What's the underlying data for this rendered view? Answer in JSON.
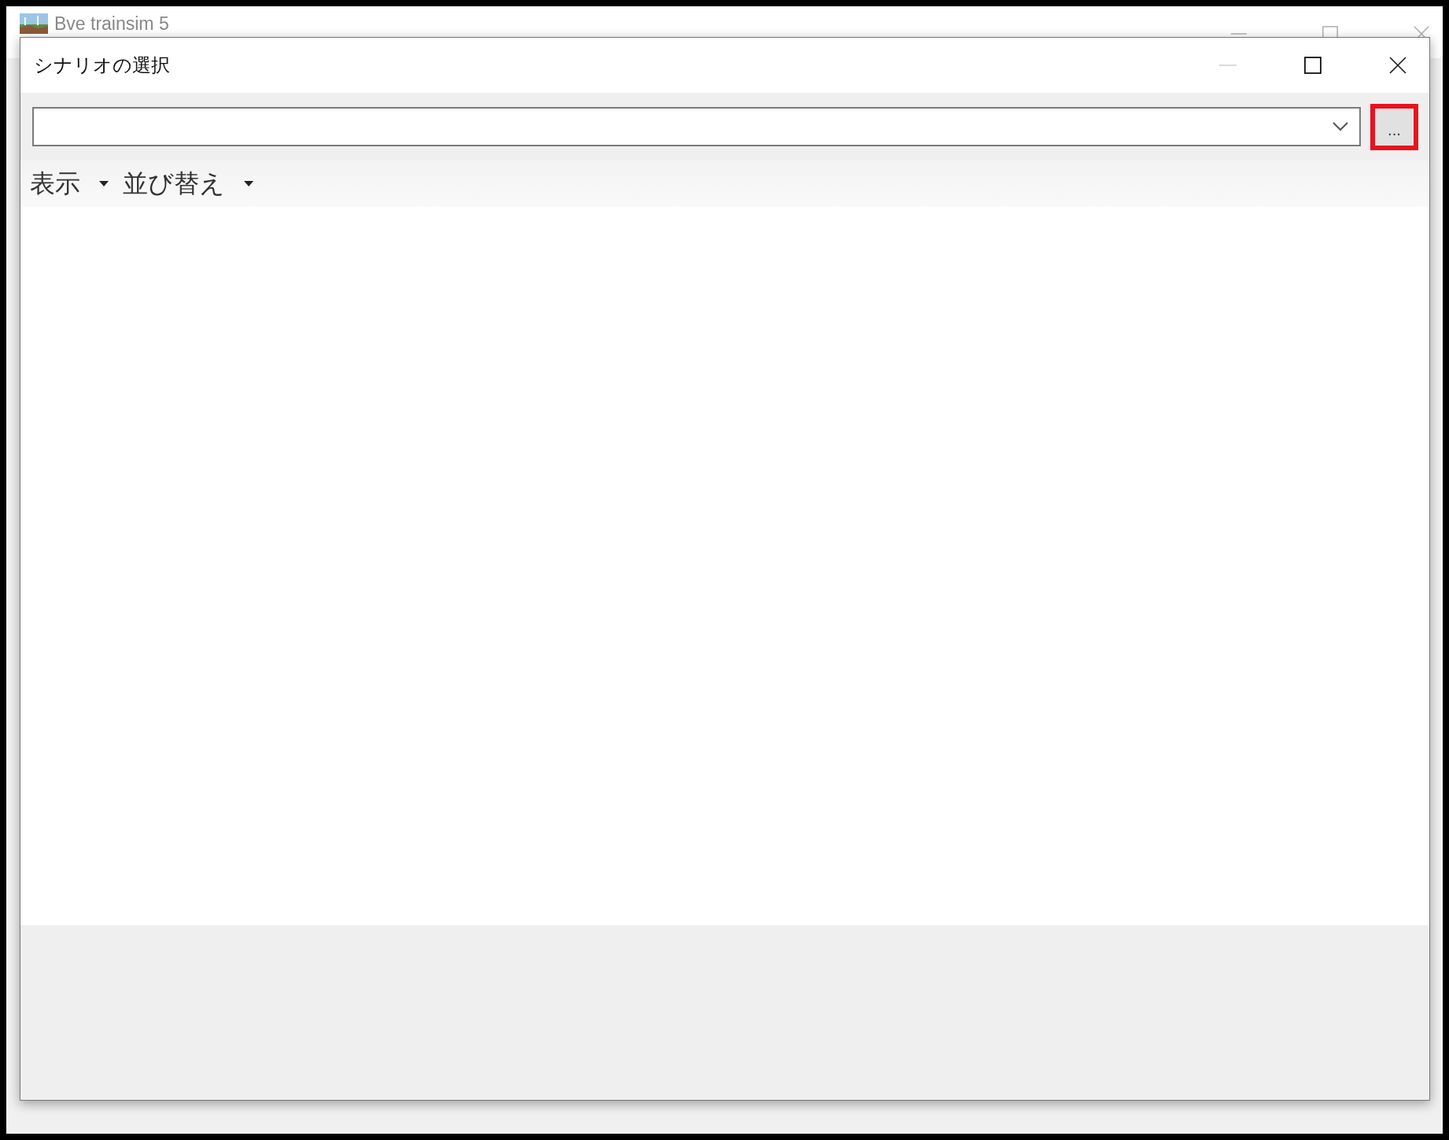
{
  "background_window": {
    "title": "Bve trainsim 5"
  },
  "dialog": {
    "title": "シナリオの選択",
    "minimize_disabled": true
  },
  "browse_button": {
    "label": "...",
    "highlighted": true
  },
  "toolbar": [
    {
      "label": "表示",
      "kind": "dropdown"
    },
    {
      "label": "並び替え",
      "kind": "dropdown"
    }
  ]
}
